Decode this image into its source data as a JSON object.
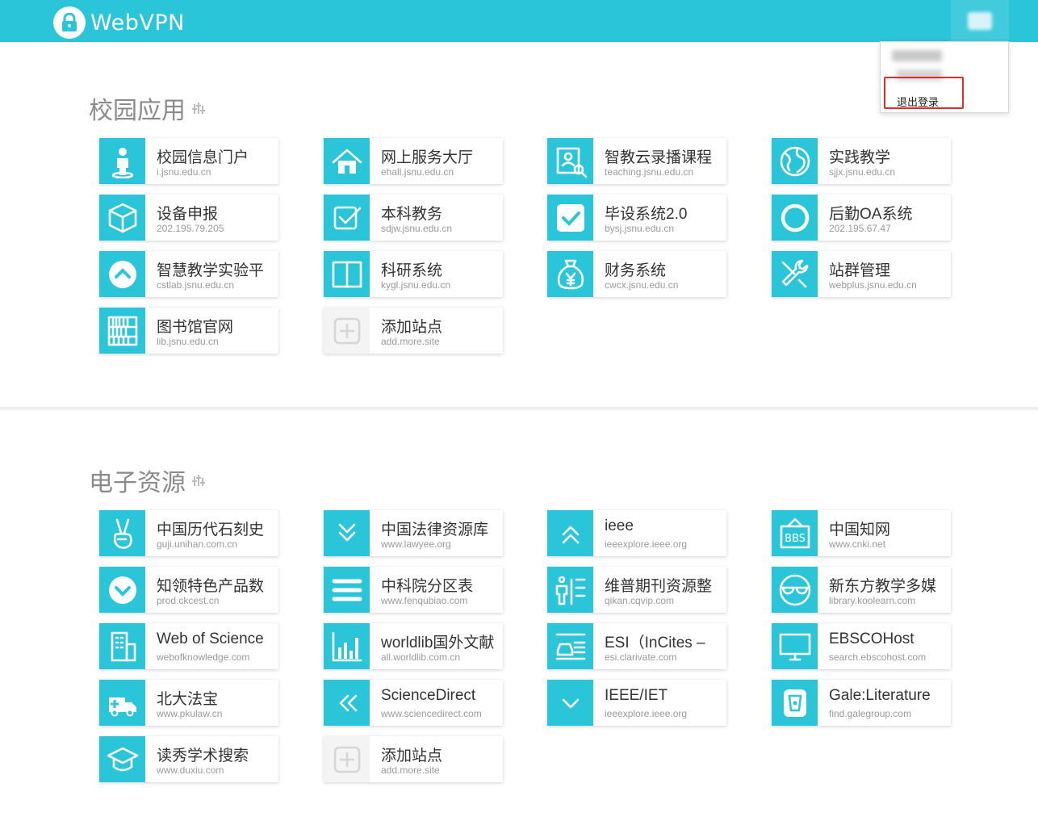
{
  "header": {
    "brand": "WebVPN"
  },
  "user_menu": {
    "logout": "退出登录"
  },
  "sections": [
    {
      "title": "校园应用",
      "cards": [
        {
          "name": "校园信息门户",
          "url": "i.jsnu.edu.cn",
          "icon": "person-icon"
        },
        {
          "name": "网上服务大厅",
          "url": "ehall.jsnu.edu.cn",
          "icon": "house-icon"
        },
        {
          "name": "智教云录播课程",
          "url": "teaching.jsnu.edu.cn",
          "icon": "profile-search-icon"
        },
        {
          "name": "实践教学",
          "url": "sjjx.jsnu.edu.cn",
          "icon": "globe-icon"
        },
        {
          "name": "设备申报",
          "url": "202.195.79.205",
          "icon": "cube-icon"
        },
        {
          "name": "本科教务",
          "url": "sdjw.jsnu.edu.cn",
          "icon": "checkbox-icon"
        },
        {
          "name": "毕设系统2.0",
          "url": "bysj.jsnu.edu.cn",
          "icon": "check-square-icon"
        },
        {
          "name": "后勤OA系统",
          "url": "202.195.67.47",
          "icon": "ring-icon"
        },
        {
          "name": "智慧教学实验平",
          "url": "cstlab.jsnu.edu.cn",
          "icon": "chevron-up-circle-icon"
        },
        {
          "name": "科研系统",
          "url": "kygl.jsnu.edu.cn",
          "icon": "columns-icon"
        },
        {
          "name": "财务系统",
          "url": "cwcx.jsnu.edu.cn",
          "icon": "money-bag-icon"
        },
        {
          "name": "站群管理",
          "url": "webplus.jsnu.edu.cn",
          "icon": "tools-icon"
        },
        {
          "name": "图书馆官网",
          "url": "lib.jsnu.edu.cn",
          "icon": "bookshelf-icon"
        },
        {
          "name": "添加站点",
          "url": "add.more.site",
          "icon": "add-icon"
        }
      ]
    },
    {
      "title": "电子资源",
      "cards": [
        {
          "name": "中国历代石刻史",
          "url": "guji.unihan.com.cn",
          "icon": "victory-hand-icon"
        },
        {
          "name": "中国法律资源库",
          "url": "www.lawyee.org",
          "icon": "double-chevron-down-icon"
        },
        {
          "name": "ieee",
          "url": "ieeexplore.ieee.org",
          "icon": "double-chevron-up-icon"
        },
        {
          "name": "中国知网",
          "url": "www.cnki.net",
          "icon": "bbs-sign-icon"
        },
        {
          "name": "知领特色产品数",
          "url": "prod.ckcest.cn",
          "icon": "chevron-down-circle-icon"
        },
        {
          "name": "中科院分区表",
          "url": "www.fenqubiao.com",
          "icon": "menu-icon"
        },
        {
          "name": "维普期刊资源整",
          "url": "qikan.cqvip.com",
          "icon": "people-list-icon"
        },
        {
          "name": "新东方教学多媒",
          "url": "library.koolearn.com",
          "icon": "glasses-icon"
        },
        {
          "name": "Web of Science",
          "url": "webofknowledge.com",
          "icon": "building-icon"
        },
        {
          "name": "worldlib国外文献",
          "url": "all.worldlib.com.cn",
          "icon": "bar-chart-icon"
        },
        {
          "name": "ESI（InCites –",
          "url": "esi.clarivate.com",
          "icon": "car-list-icon"
        },
        {
          "name": "EBSCOHost",
          "url": "search.ebscohost.com",
          "icon": "monitor-icon"
        },
        {
          "name": "北大法宝",
          "url": "www.pkulaw.cn",
          "icon": "ambulance-icon"
        },
        {
          "name": "ScienceDirect",
          "url": "www.sciencedirect.com",
          "icon": "double-chevron-left-icon"
        },
        {
          "name": "IEEE/IET",
          "url": "ieeexplore.ieee.org",
          "icon": "chevron-down-icon"
        },
        {
          "name": "Gale:Literature",
          "url": "find.galegroup.com",
          "icon": "cup-icon"
        },
        {
          "name": "读秀学术搜索",
          "url": "www.duxiu.com",
          "icon": "graduation-cap-icon"
        },
        {
          "name": "添加站点",
          "url": "add.more.site",
          "icon": "add-icon"
        }
      ]
    }
  ],
  "colors": {
    "accent": "#2bc5d9",
    "logout_highlight": "#e02b2b",
    "title_gray": "#8b8b8b"
  }
}
